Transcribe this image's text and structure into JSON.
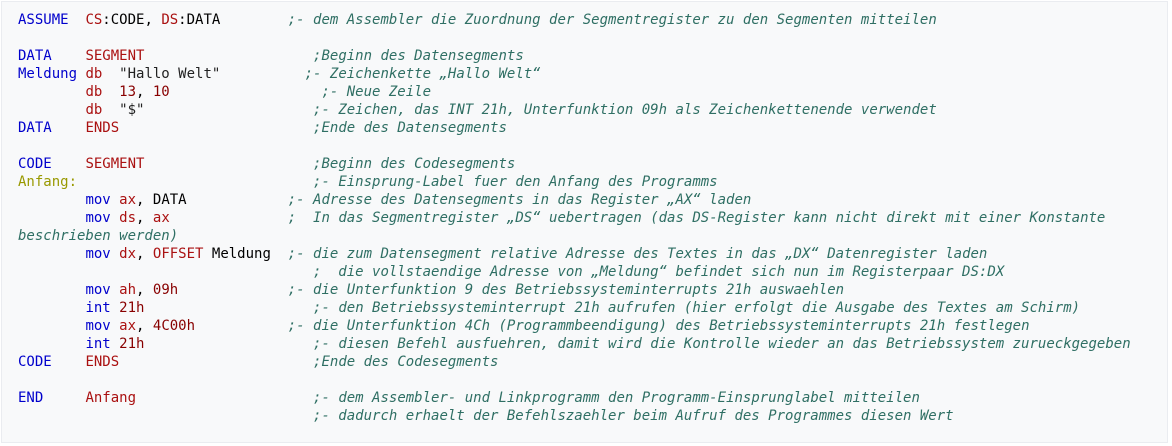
{
  "lines": [
    {
      "parts": [
        {
          "t": "ASSUME  ",
          "c": "kw"
        },
        {
          "t": "CS",
          "c": "dir"
        },
        {
          "t": ":CODE, ",
          "c": "op"
        },
        {
          "t": "DS",
          "c": "dir"
        },
        {
          "t": ":DATA        ",
          "c": "op"
        },
        {
          "t": ";- dem Assembler die Zuordnung der Segmentregister zu den Segmenten mitteilen",
          "c": "cm"
        }
      ]
    },
    {
      "parts": []
    },
    {
      "parts": [
        {
          "t": "DATA    ",
          "c": "kw"
        },
        {
          "t": "SEGMENT",
          "c": "dir"
        },
        {
          "t": "                    ",
          "c": "op"
        },
        {
          "t": ";Beginn des Datensegments",
          "c": "cm"
        }
      ]
    },
    {
      "parts": [
        {
          "t": "Meldung ",
          "c": "kw"
        },
        {
          "t": "db  ",
          "c": "dir"
        },
        {
          "t": "\"Hallo Welt\"",
          "c": "str"
        },
        {
          "t": "          ",
          "c": "op"
        },
        {
          "t": ";- Zeichenkette „Hallo Welt“",
          "c": "cm"
        }
      ]
    },
    {
      "parts": [
        {
          "t": "        ",
          "c": "op"
        },
        {
          "t": "db  ",
          "c": "dir"
        },
        {
          "t": "13",
          "c": "num"
        },
        {
          "t": ", ",
          "c": "op"
        },
        {
          "t": "10",
          "c": "num"
        },
        {
          "t": "                  ",
          "c": "op"
        },
        {
          "t": ";- Neue Zeile",
          "c": "cm"
        }
      ]
    },
    {
      "parts": [
        {
          "t": "        ",
          "c": "op"
        },
        {
          "t": "db  ",
          "c": "dir"
        },
        {
          "t": "\"$\"",
          "c": "str"
        },
        {
          "t": "                    ",
          "c": "op"
        },
        {
          "t": ";- Zeichen, das INT 21h, Unterfunktion 09h als Zeichenkettenende verwendet",
          "c": "cm"
        }
      ]
    },
    {
      "parts": [
        {
          "t": "DATA    ",
          "c": "kw"
        },
        {
          "t": "ENDS",
          "c": "dir"
        },
        {
          "t": "                       ",
          "c": "op"
        },
        {
          "t": ";Ende des Datensegments",
          "c": "cm"
        }
      ]
    },
    {
      "parts": []
    },
    {
      "parts": [
        {
          "t": "CODE    ",
          "c": "kw"
        },
        {
          "t": "SEGMENT",
          "c": "dir"
        },
        {
          "t": "                    ",
          "c": "op"
        },
        {
          "t": ";Beginn des Codesegments",
          "c": "cm"
        }
      ]
    },
    {
      "parts": [
        {
          "t": "Anfang:",
          "c": "lbl"
        },
        {
          "t": "                            ",
          "c": "op"
        },
        {
          "t": ";- Einsprung-Label fuer den Anfang des Programms",
          "c": "cm"
        }
      ]
    },
    {
      "parts": [
        {
          "t": "        ",
          "c": "op"
        },
        {
          "t": "mov",
          "c": "kw"
        },
        {
          "t": " ",
          "c": "op"
        },
        {
          "t": "ax",
          "c": "dir"
        },
        {
          "t": ", DATA            ",
          "c": "op"
        },
        {
          "t": ";- Adresse des Datensegments in das Register „AX“ laden",
          "c": "cm"
        }
      ]
    },
    {
      "parts": [
        {
          "t": "        ",
          "c": "op"
        },
        {
          "t": "mov",
          "c": "kw"
        },
        {
          "t": " ",
          "c": "op"
        },
        {
          "t": "ds",
          "c": "dir"
        },
        {
          "t": ", ",
          "c": "op"
        },
        {
          "t": "ax",
          "c": "dir"
        },
        {
          "t": "              ",
          "c": "op"
        },
        {
          "t": ";  In das Segmentregister „DS“ uebertragen (das DS-Register kann nicht direkt mit einer Konstante",
          "c": "cm"
        }
      ]
    },
    {
      "parts": [
        {
          "t": "beschrieben werden)",
          "c": "cm"
        }
      ]
    },
    {
      "parts": [
        {
          "t": "        ",
          "c": "op"
        },
        {
          "t": "mov",
          "c": "kw"
        },
        {
          "t": " ",
          "c": "op"
        },
        {
          "t": "dx",
          "c": "dir"
        },
        {
          "t": ", ",
          "c": "op"
        },
        {
          "t": "OFFSET",
          "c": "dir"
        },
        {
          "t": " Meldung  ",
          "c": "op"
        },
        {
          "t": ";- die zum Datensegment relative Adresse des Textes in das „DX“ Datenregister laden",
          "c": "cm"
        }
      ]
    },
    {
      "parts": [
        {
          "t": "                                   ",
          "c": "op"
        },
        {
          "t": ";  die vollstaendige Adresse von „Meldung“ befindet sich nun im Registerpaar DS:DX",
          "c": "cm"
        }
      ]
    },
    {
      "parts": [
        {
          "t": "        ",
          "c": "op"
        },
        {
          "t": "mov",
          "c": "kw"
        },
        {
          "t": " ",
          "c": "op"
        },
        {
          "t": "ah",
          "c": "dir"
        },
        {
          "t": ", ",
          "c": "op"
        },
        {
          "t": "09h",
          "c": "num"
        },
        {
          "t": "             ",
          "c": "op"
        },
        {
          "t": ";- die Unterfunktion 9 des Betriebssysteminterrupts 21h auswaehlen",
          "c": "cm"
        }
      ]
    },
    {
      "parts": [
        {
          "t": "        ",
          "c": "op"
        },
        {
          "t": "int",
          "c": "kw"
        },
        {
          "t": " ",
          "c": "op"
        },
        {
          "t": "21h",
          "c": "num"
        },
        {
          "t": "                    ",
          "c": "op"
        },
        {
          "t": ";- den Betriebssysteminterrupt 21h aufrufen (hier erfolgt die Ausgabe des Textes am Schirm)",
          "c": "cm"
        }
      ]
    },
    {
      "parts": [
        {
          "t": "        ",
          "c": "op"
        },
        {
          "t": "mov",
          "c": "kw"
        },
        {
          "t": " ",
          "c": "op"
        },
        {
          "t": "ax",
          "c": "dir"
        },
        {
          "t": ", ",
          "c": "op"
        },
        {
          "t": "4C00h",
          "c": "num"
        },
        {
          "t": "           ",
          "c": "op"
        },
        {
          "t": ";- die Unterfunktion 4Ch (Programmbeendigung) des Betriebssysteminterrupts 21h festlegen",
          "c": "cm"
        }
      ]
    },
    {
      "parts": [
        {
          "t": "        ",
          "c": "op"
        },
        {
          "t": "int",
          "c": "kw"
        },
        {
          "t": " ",
          "c": "op"
        },
        {
          "t": "21h",
          "c": "num"
        },
        {
          "t": "                    ",
          "c": "op"
        },
        {
          "t": ";- diesen Befehl ausfuehren, damit wird die Kontrolle wieder an das Betriebssystem zurueckgegeben",
          "c": "cm"
        }
      ]
    },
    {
      "parts": [
        {
          "t": "CODE    ",
          "c": "kw"
        },
        {
          "t": "ENDS",
          "c": "dir"
        },
        {
          "t": "                       ",
          "c": "op"
        },
        {
          "t": ";Ende des Codesegments",
          "c": "cm"
        }
      ]
    },
    {
      "parts": []
    },
    {
      "parts": [
        {
          "t": "END     ",
          "c": "kw"
        },
        {
          "t": "Anfang",
          "c": "dir"
        },
        {
          "t": "                     ",
          "c": "op"
        },
        {
          "t": ";- dem Assembler- und Linkprogramm den Programm-Einsprunglabel mitteilen",
          "c": "cm"
        }
      ]
    },
    {
      "parts": [
        {
          "t": "                                   ",
          "c": "op"
        },
        {
          "t": ";- dadurch erhaelt der Befehlszaehler beim Aufruf des Programmes diesen Wert",
          "c": "cm"
        }
      ]
    }
  ]
}
